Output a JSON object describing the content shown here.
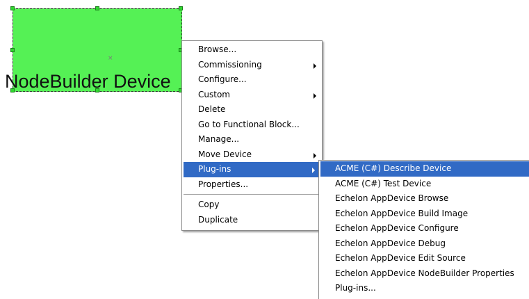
{
  "canvas": {
    "device_label": "NodeBuilder Device",
    "center_mark": "×",
    "shape_color": "#55f155"
  },
  "context_menu": {
    "items": [
      {
        "label": "Browse...",
        "submenu": false
      },
      {
        "label": "Commissioning",
        "submenu": true
      },
      {
        "label": "Configure...",
        "submenu": false
      },
      {
        "label": "Custom",
        "submenu": true
      },
      {
        "label": "Delete",
        "submenu": false
      },
      {
        "label": "Go to Functional Block...",
        "submenu": false
      },
      {
        "label": "Manage...",
        "submenu": false
      },
      {
        "label": "Move Device",
        "submenu": true
      },
      {
        "label": "Plug-ins",
        "submenu": true,
        "highlighted": true
      },
      {
        "label": "Properties...",
        "submenu": false
      },
      {
        "label": "Copy",
        "submenu": false
      },
      {
        "label": "Duplicate",
        "submenu": false
      }
    ]
  },
  "plugins_submenu": {
    "items": [
      {
        "label": "ACME (C#) Describe Device",
        "highlighted": true
      },
      {
        "label": "ACME (C#) Test Device"
      },
      {
        "label": "Echelon AppDevice Browse"
      },
      {
        "label": "Echelon AppDevice Build Image"
      },
      {
        "label": "Echelon AppDevice Configure"
      },
      {
        "label": "Echelon AppDevice Debug"
      },
      {
        "label": "Echelon AppDevice Edit Source"
      },
      {
        "label": "Echelon AppDevice NodeBuilder Properties"
      },
      {
        "label": "Plug-ins..."
      }
    ]
  },
  "colors": {
    "highlight": "#316ac5",
    "menu_border": "#8a8a8a"
  }
}
